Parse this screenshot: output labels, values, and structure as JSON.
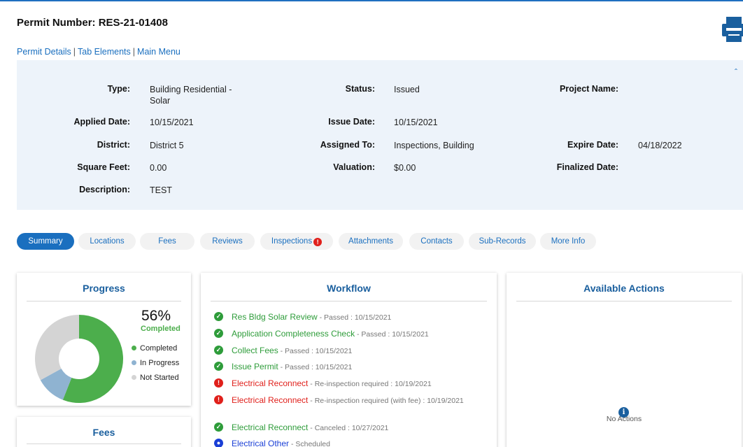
{
  "header": {
    "permit_title": "Permit Number: RES-21-01408",
    "nav": [
      "Permit Details",
      "Tab Elements",
      "Main Menu"
    ]
  },
  "details": {
    "type_label": "Type:",
    "type_value_1": "Building Residential -",
    "type_value_2": "Solar",
    "status_label": "Status:",
    "status_value": "Issued",
    "project_label": "Project Name:",
    "applied_label": "Applied Date:",
    "applied_value": "10/15/2021",
    "issue_label": "Issue Date:",
    "issue_value": "10/15/2021",
    "district_label": "District:",
    "district_value": "District 5",
    "assigned_label": "Assigned To:",
    "assigned_value": "Inspections, Building",
    "expire_label": "Expire Date:",
    "expire_value": "04/18/2022",
    "sqft_label": "Square Feet:",
    "sqft_value": "0.00",
    "valuation_label": "Valuation:",
    "valuation_value": "$0.00",
    "finalized_label": "Finalized Date:",
    "description_label": "Description:",
    "description_value": "TEST"
  },
  "tabs": [
    {
      "label": "Summary",
      "active": true
    },
    {
      "label": "Locations"
    },
    {
      "label": "Fees"
    },
    {
      "label": "Reviews"
    },
    {
      "label": "Inspections",
      "badge": "!"
    },
    {
      "label": "Attachments"
    },
    {
      "label": "Contacts"
    },
    {
      "label": "Sub-Records"
    },
    {
      "label": "More Info"
    }
  ],
  "progress": {
    "title": "Progress",
    "percent": "56%",
    "percent_label": "Completed",
    "completed_fraction": 0.56,
    "in_progress_fraction": 0.11,
    "legend": [
      "Completed",
      "In Progress",
      "Not Started"
    ],
    "colors": {
      "completed": "#4cae4c",
      "in_progress": "#8fb3d1",
      "not_started": "#d4d4d4"
    }
  },
  "fees_card": {
    "title": "Fees"
  },
  "workflow": {
    "title": "Workflow",
    "items": [
      {
        "name": "Res Bldg Solar Review",
        "detail": " - Passed : 10/15/2021",
        "state": "passed"
      },
      {
        "name": "Application Completeness Check",
        "detail": " - Passed : 10/15/2021",
        "state": "passed"
      },
      {
        "name": "Collect Fees",
        "detail": " - Passed : 10/15/2021",
        "state": "passed"
      },
      {
        "name": "Issue Permit",
        "detail": " - Passed : 10/15/2021",
        "state": "passed"
      },
      {
        "name": "Electrical Reconnect",
        "detail": " - Re-inspection required : 10/19/2021",
        "state": "failed"
      },
      {
        "name": "Electrical Reconnect",
        "detail": " - Re-inspection required (with fee) : 10/19/2021",
        "state": "failed"
      },
      {
        "name": "Electrical Reconnect",
        "detail": " - Canceled : 10/27/2021",
        "state": "passed"
      },
      {
        "name": "Electrical Other",
        "detail": " - Scheduled",
        "state": "scheduled"
      }
    ]
  },
  "actions": {
    "title": "Available Actions",
    "empty_text": "No Actions"
  },
  "state_colors": {
    "passed": "#2e9c3a",
    "failed": "#e0201b",
    "scheduled": "#1a3fd6"
  }
}
